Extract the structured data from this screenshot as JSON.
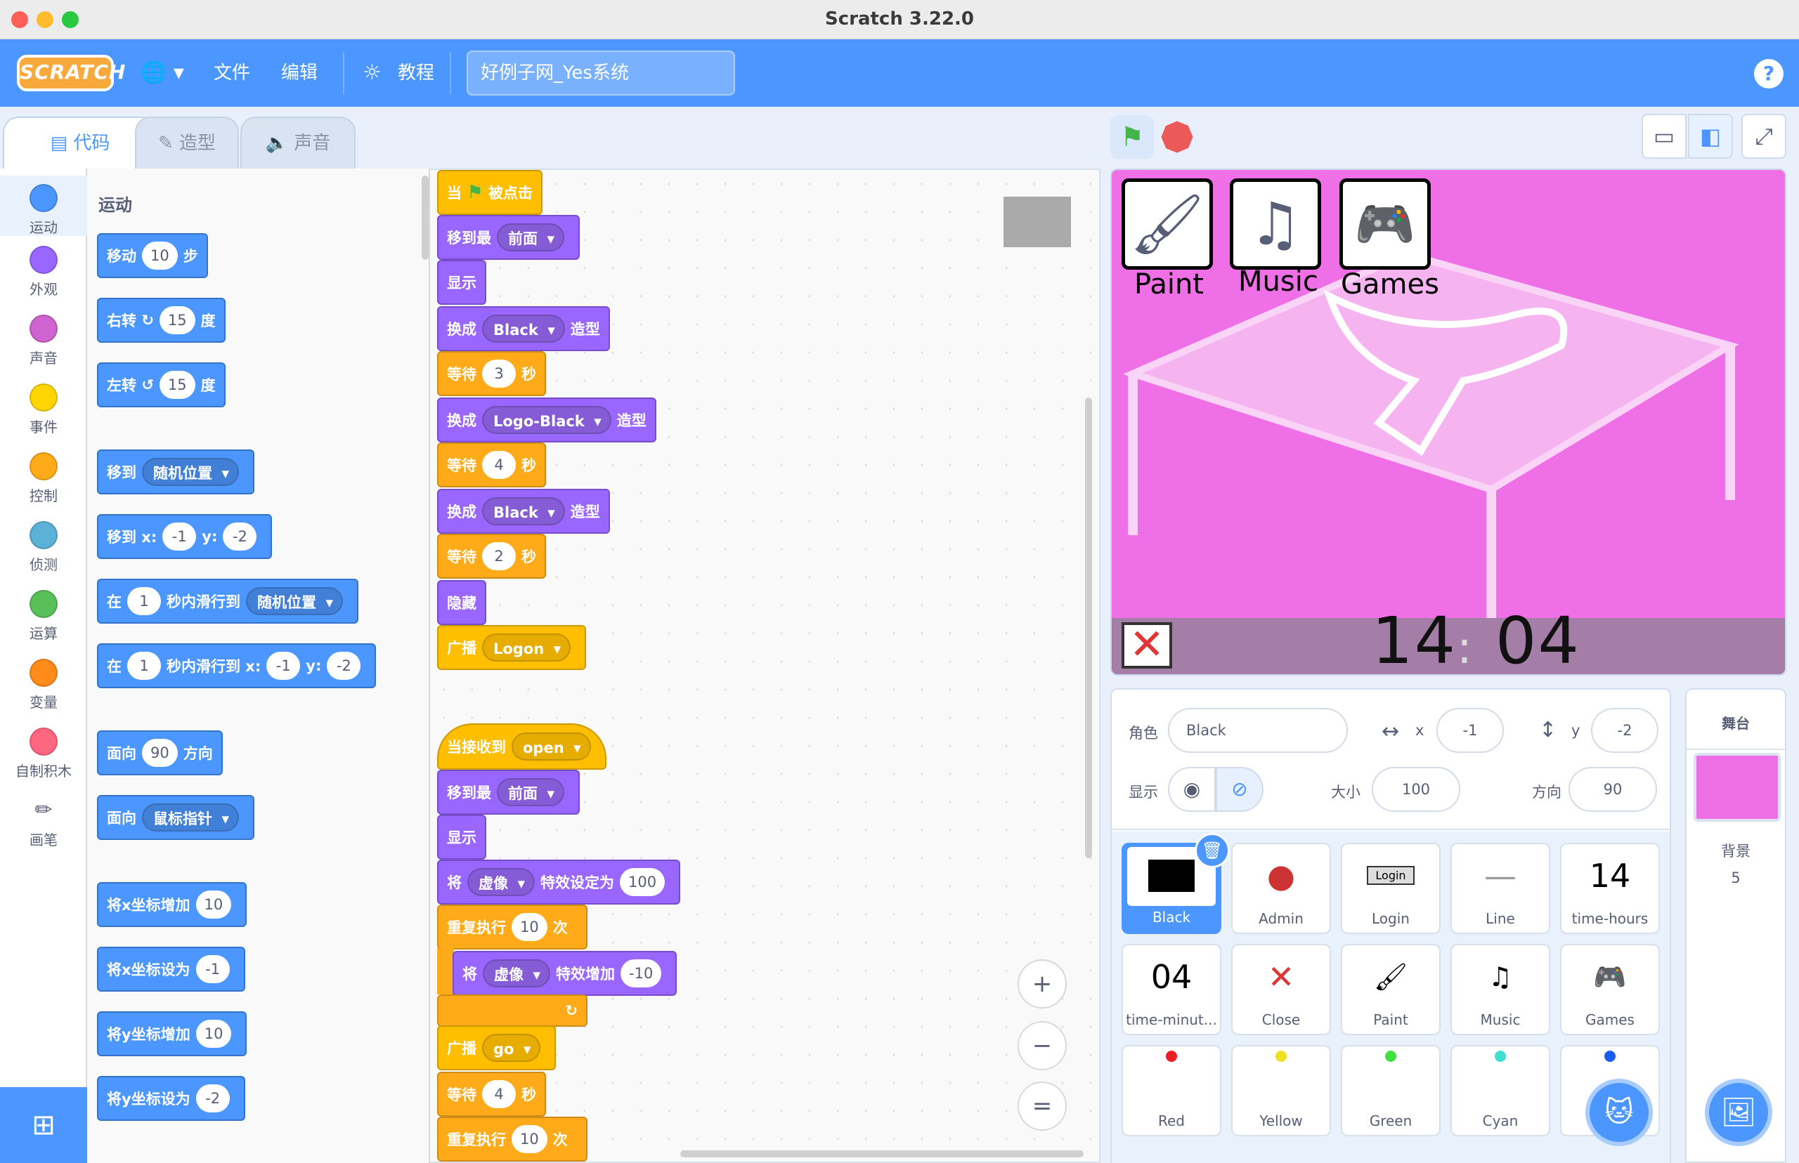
{
  "window": {
    "title": "Scratch 3.22.0"
  },
  "menubar": {
    "logo": "SCRATCH",
    "globe": "🌐 ▾",
    "file": "文件",
    "edit": "编辑",
    "tutorials": "教程",
    "project_title": "好例子网_Yes系统",
    "help": "?"
  },
  "tabs": {
    "code": "代码",
    "costumes": "造型",
    "sounds": "声音"
  },
  "categories": [
    {
      "label": "运动",
      "color": "#4c97ff"
    },
    {
      "label": "外观",
      "color": "#9966ff"
    },
    {
      "label": "声音",
      "color": "#cf63cf"
    },
    {
      "label": "事件",
      "color": "#ffd500"
    },
    {
      "label": "控制",
      "color": "#ffab19"
    },
    {
      "label": "侦测",
      "color": "#5cb1d6"
    },
    {
      "label": "运算",
      "color": "#59c059"
    },
    {
      "label": "变量",
      "color": "#ff8c1a"
    },
    {
      "label": "自制积木",
      "color": "#ff6680"
    },
    {
      "label": "画笔",
      "color": "#0fbd8c"
    }
  ],
  "palette": {
    "title": "运动",
    "move": {
      "a": "移动",
      "v": "10",
      "b": "步"
    },
    "turn_right": {
      "a": "右转",
      "icon": "↻",
      "v": "15",
      "b": "度"
    },
    "turn_left": {
      "a": "左转",
      "icon": "↺",
      "v": "15",
      "b": "度"
    },
    "goto": {
      "a": "移到",
      "dd": "随机位置"
    },
    "goto_xy": {
      "a": "移到 x:",
      "x": "-1",
      "b": "y:",
      "y": "-2"
    },
    "glide": {
      "a": "在",
      "v": "1",
      "b": "秒内滑行到",
      "dd": "随机位置"
    },
    "glide_xy": {
      "a": "在",
      "v": "1",
      "b": "秒内滑行到 x:",
      "x": "-1",
      "c": "y:",
      "y": "-2"
    },
    "point_dir": {
      "a": "面向",
      "v": "90",
      "b": "方向"
    },
    "point_towards": {
      "a": "面向",
      "dd": "鼠标指针"
    },
    "change_x": {
      "a": "将x坐标增加",
      "v": "10"
    },
    "set_x": {
      "a": "将x坐标设为",
      "v": "-1"
    },
    "change_y": {
      "a": "将y坐标增加",
      "v": "10"
    },
    "set_y": {
      "a": "将y坐标设为",
      "v": "-2"
    }
  },
  "script1": {
    "hat": {
      "a": "当",
      "b": "被点击"
    },
    "front1": {
      "a": "移到最",
      "dd": "前面"
    },
    "show": "显示",
    "sw1": {
      "a": "换成",
      "dd": "Black",
      "b": "造型"
    },
    "wait1": {
      "a": "等待",
      "v": "3",
      "b": "秒"
    },
    "sw2": {
      "a": "换成",
      "dd": "Logo-Black",
      "b": "造型"
    },
    "wait2": {
      "a": "等待",
      "v": "4",
      "b": "秒"
    },
    "sw3": {
      "a": "换成",
      "dd": "Black",
      "b": "造型"
    },
    "wait3": {
      "a": "等待",
      "v": "2",
      "b": "秒"
    },
    "hide": "隐藏",
    "bc": {
      "a": "广播",
      "dd": "Logon"
    }
  },
  "script2": {
    "hat": {
      "a": "当接收到",
      "dd": "open"
    },
    "front": {
      "a": "移到最",
      "dd": "前面"
    },
    "show": "显示",
    "seteff": {
      "a": "将",
      "dd": "虚像",
      "b": "特效设定为",
      "v": "100"
    },
    "repeat": {
      "a": "重复执行",
      "v": "10",
      "b": "次"
    },
    "chgeff": {
      "a": "将",
      "dd": "虚像",
      "b": "特效增加",
      "v": "-10"
    },
    "bc": {
      "a": "广播",
      "dd": "go"
    },
    "wait": {
      "a": "等待",
      "v": "4",
      "b": "秒"
    },
    "repeat2": {
      "a": "重复执行",
      "v": "10",
      "b": "次"
    }
  },
  "zoom": {
    "in": "+",
    "out": "−",
    "reset": "="
  },
  "stage": {
    "apps": [
      {
        "icon": "🖌",
        "label": "Paint"
      },
      {
        "icon": "♫",
        "label": "Music"
      },
      {
        "icon": "🎮",
        "label": "Games"
      }
    ],
    "close": "✕",
    "clock_h": "14",
    "clock_sep": ":",
    "clock_m": "04"
  },
  "sprite_info": {
    "sprite_label": "角色",
    "sprite_name": "Black",
    "x_label": "x",
    "x": "-1",
    "y_label": "y",
    "y": "-2",
    "show_label": "显示",
    "size_label": "大小",
    "size": "100",
    "dir_label": "方向",
    "direction": "90"
  },
  "sprites": [
    {
      "name": "Black",
      "thumb": "■"
    },
    {
      "name": "Admin",
      "thumb": "●"
    },
    {
      "name": "Login",
      "thumb": "Login"
    },
    {
      "name": "Line",
      "thumb": "—"
    },
    {
      "name": "time-hours",
      "thumb": "14"
    },
    {
      "name": "time-minut...",
      "thumb": "04"
    },
    {
      "name": "Close",
      "thumb": "✕"
    },
    {
      "name": "Paint",
      "thumb": "🖌"
    },
    {
      "name": "Music",
      "thumb": "♫"
    },
    {
      "name": "Games",
      "thumb": "🎮"
    },
    {
      "name": "Red",
      "color": "#ee1c24"
    },
    {
      "name": "Yellow",
      "color": "#f0e020"
    },
    {
      "name": "Green",
      "color": "#40e040"
    },
    {
      "name": "Cyan",
      "color": "#40e0d0"
    },
    {
      "name": "",
      "color": "#1a5cf0"
    }
  ],
  "stage_panel": {
    "title": "舞台",
    "backdrops_label": "背景",
    "backdrops_count": "5"
  }
}
